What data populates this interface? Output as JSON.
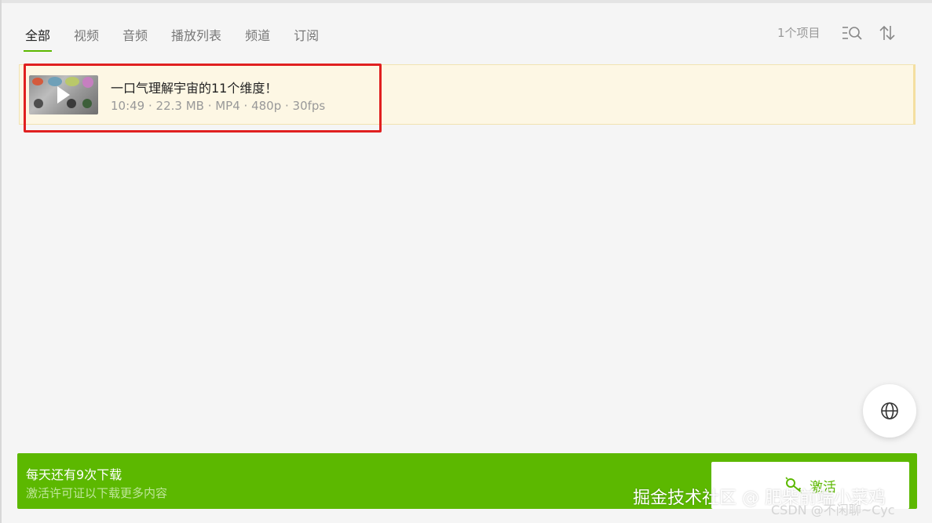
{
  "tabs": [
    {
      "label": "全部",
      "active": true
    },
    {
      "label": "视频"
    },
    {
      "label": "音频"
    },
    {
      "label": "播放列表"
    },
    {
      "label": "频道"
    },
    {
      "label": "订阅"
    }
  ],
  "toolbar": {
    "item_count": "1个项目",
    "search_icon": "list-search-icon",
    "sort_icon": "sort-icon"
  },
  "items": [
    {
      "title": "一口气理解宇宙的11个维度！",
      "meta": "10:49 · 22.3 MB · MP4 · 480p · 30fps",
      "thumbnail_icon": "video-thumbnail",
      "play_icon": "play-icon"
    }
  ],
  "floating": {
    "icon": "globe-icon"
  },
  "banner": {
    "line1": "每天还有9次下载",
    "line2": "激活许可证以下载更多内容",
    "activate_label": "激活",
    "activate_icon": "key-icon"
  },
  "watermarks": {
    "primary": "掘金技术社区 @ 肥柴前端小菜鸡",
    "secondary": "CSDN @不闲聊~Cyc"
  },
  "colors": {
    "accent": "#5cb800",
    "highlight_row": "#fdf7e4",
    "annotation_red": "#e02020"
  }
}
